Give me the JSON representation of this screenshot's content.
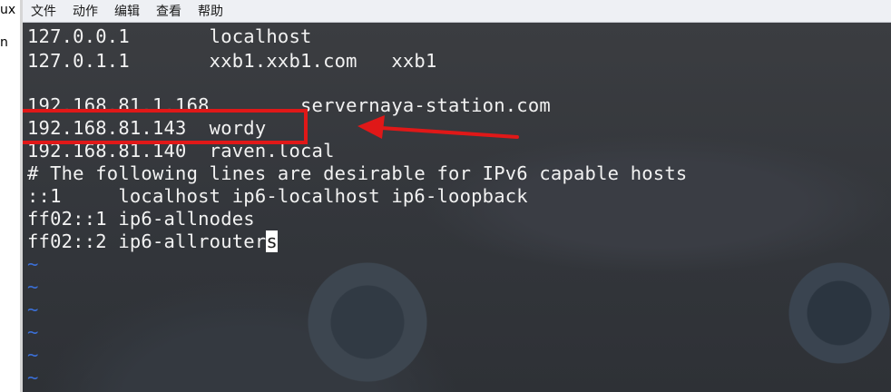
{
  "side_panel": {
    "top_text": "ux",
    "mid_text": "n"
  },
  "menubar": {
    "items": [
      "文件",
      "动作",
      "编辑",
      "查看",
      "帮助"
    ]
  },
  "editor": {
    "lines": [
      "127.0.0.1       localhost",
      "127.0.1.1       xxb1.xxb1.com   xxb1",
      "",
      "192.168.81.1.168        servernaya-station.com",
      "192.168.81.143  wordy",
      "192.168.81.140  raven.local",
      "# The following lines are desirable for IPv6 capable hosts",
      "::1     localhost ip6-localhost ip6-loopback",
      "ff02::1 ip6-allnodes",
      "ff02::2 ip6-allrouter"
    ],
    "cursor_char": "s",
    "empty_line_marker": "~",
    "highlighted_entry": "192.168.81.143  wordy"
  },
  "colors": {
    "highlight": "#e01818",
    "tilde": "#3b6fd6",
    "text": "#f2f2f2"
  }
}
